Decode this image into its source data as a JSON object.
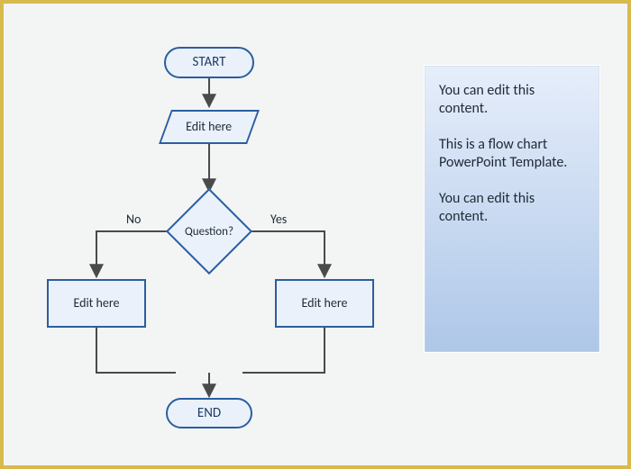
{
  "flowchart": {
    "start": "START",
    "io": "Edit here",
    "decision": "Question?",
    "branch_no": "No",
    "branch_yes": "Yes",
    "process_left": "Edit here",
    "process_right": "Edit here",
    "end": "END"
  },
  "info": {
    "p1": "You can edit this content.",
    "p2": "This is a flow chart PowerPoint Template.",
    "p3": "You can edit this content."
  },
  "colors": {
    "frame": "#d8b94e",
    "shape_fill": "#eaf1fa",
    "shape_stroke": "#2a5ea1",
    "connector": "#4a4a4a",
    "panel_top": "#e6eefb",
    "panel_bottom": "#aec7e8"
  }
}
